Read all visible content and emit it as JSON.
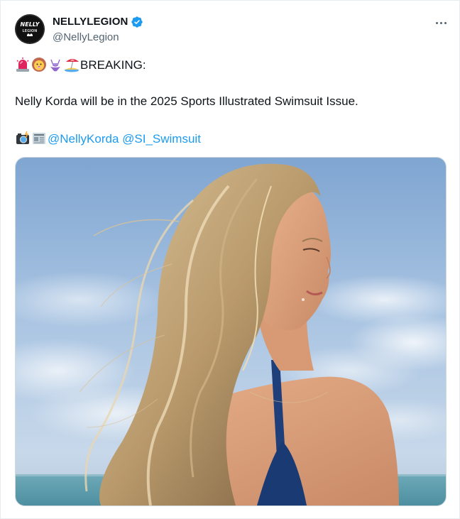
{
  "author": {
    "name": "NELLYLEGION",
    "handle": "@NellyLegion",
    "verified": true,
    "avatar_text": "NELLY LEGION"
  },
  "tweet": {
    "line1_emojis": [
      "rotating-light",
      "lion-face",
      "bikini",
      "beach-with-umbrella"
    ],
    "line1_text": "BREAKING:",
    "body": "Nelly Korda will be in the 2025 Sports Illustrated Swimsuit Issue.",
    "line3_emojis": [
      "camera-with-flash",
      "newspaper"
    ],
    "mentions": [
      "@NellyKorda",
      "@SI_Swimsuit"
    ]
  },
  "colors": {
    "link": "#1d9bf0",
    "verified": "#1d9bf0",
    "text": "#0f1419",
    "secondary": "#536471"
  },
  "icons": {
    "more": "more-horizontal-icon",
    "verified": "verified-badge-icon"
  }
}
